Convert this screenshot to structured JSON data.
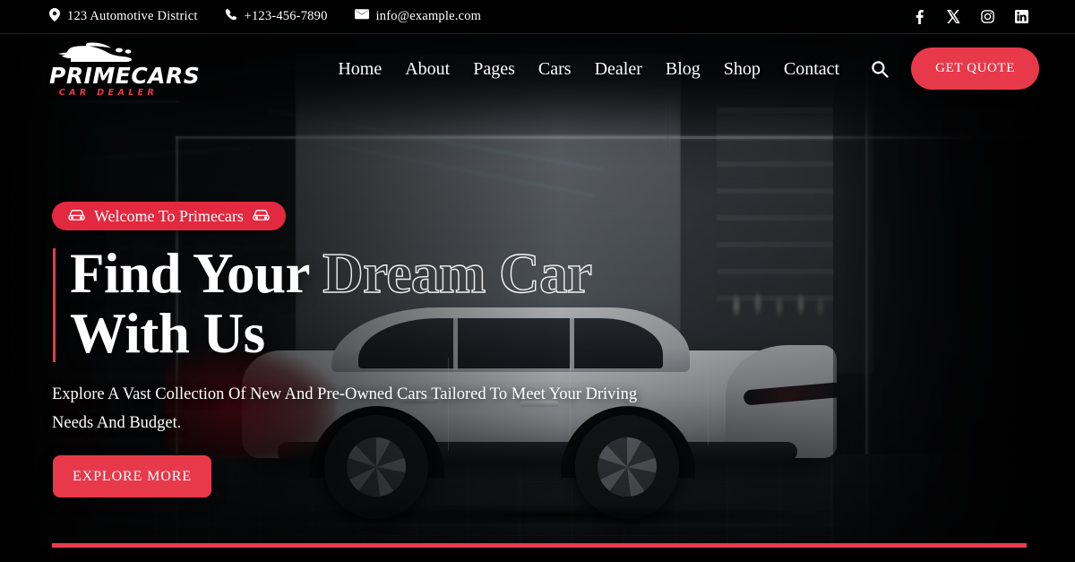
{
  "topbar": {
    "address": "123 Automotive District",
    "phone": "+123-456-7890",
    "email": "info@example.com",
    "socials": [
      {
        "name": "facebook",
        "label": "f"
      },
      {
        "name": "x-twitter",
        "label": "X"
      },
      {
        "name": "instagram",
        "label": ""
      },
      {
        "name": "linkedin",
        "label": "in"
      }
    ]
  },
  "brand": {
    "name": "PRIMECARS",
    "tagline": "CAR DEALER"
  },
  "nav": {
    "items": [
      {
        "label": "Home"
      },
      {
        "label": "About"
      },
      {
        "label": "Pages"
      },
      {
        "label": "Cars"
      },
      {
        "label": "Dealer"
      },
      {
        "label": "Blog"
      },
      {
        "label": "Shop"
      },
      {
        "label": "Contact"
      }
    ],
    "search_label": "Search",
    "quote_label": "GET QUOTE"
  },
  "hero": {
    "badge": "Welcome To Primecars",
    "headline_solid_1": "Find Your ",
    "headline_outline": "Dream Car",
    "headline_solid_2": "With Us",
    "subtext": "Explore A Vast Collection Of New And Pre-Owned Cars Tailored To Meet Your Driving Needs And Budget.",
    "cta_label": "EXPLORE MORE"
  },
  "colors": {
    "accent_red": "#e8394b",
    "badge_red": "#e2293f",
    "rule_red": "#ea3b4d",
    "text_white": "#ffffff",
    "background_dark": "#050607"
  }
}
